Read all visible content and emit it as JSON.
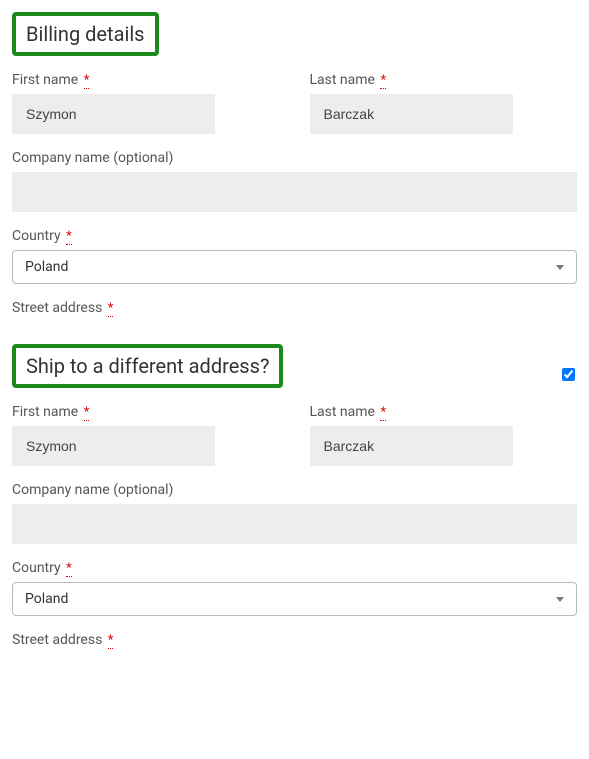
{
  "billing": {
    "heading": "Billing details",
    "first_name_label": "First name",
    "first_name_value": "Szymon",
    "last_name_label": "Last name",
    "last_name_value": "Barczak",
    "company_label": "Company name (optional)",
    "company_value": "",
    "country_label": "Country",
    "country_value": "Poland",
    "street_label": "Street address",
    "required_mark": "*"
  },
  "shipping": {
    "heading": "Ship to a different address?",
    "checked": true,
    "first_name_label": "First name",
    "first_name_value": "Szymon",
    "last_name_label": "Last name",
    "last_name_value": "Barczak",
    "company_label": "Company name (optional)",
    "company_value": "",
    "country_label": "Country",
    "country_value": "Poland",
    "street_label": "Street address",
    "required_mark": "*"
  }
}
